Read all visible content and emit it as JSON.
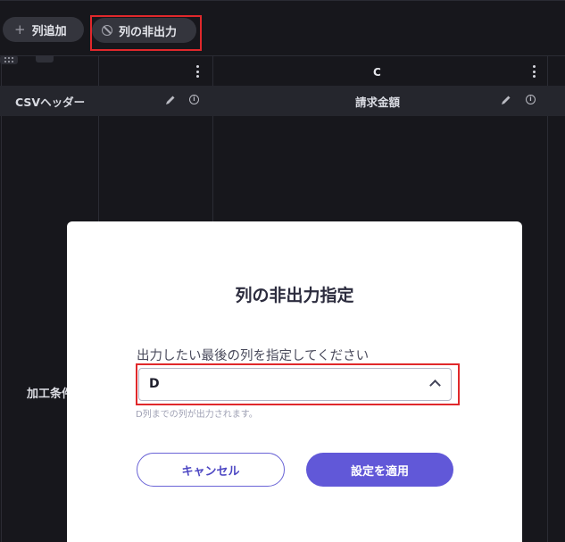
{
  "toolbar": {
    "add_column_label": "列追加",
    "hide_column_label": "列の非出力"
  },
  "grid": {
    "column_letter": "C",
    "header_cells": [
      "CSVヘッダー",
      "請求金額"
    ],
    "row_label": "加工条件"
  },
  "modal": {
    "title": "列の非出力指定",
    "field_label": "出力したい最後の列を指定してください",
    "selected_value": "D",
    "helper_text": "D列までの列が出力されます。",
    "cancel_label": "キャンセル",
    "apply_label": "設定を適用"
  },
  "icons": {
    "add": "plus-icon",
    "hide": "ban-icon",
    "edit": "pencil-icon",
    "info": "info-icon",
    "menu": "kebab-icon",
    "select": "chevron-up-icon"
  },
  "colors": {
    "accent": "#6158d8",
    "highlight": "#e0282b",
    "background": "#17171c"
  }
}
